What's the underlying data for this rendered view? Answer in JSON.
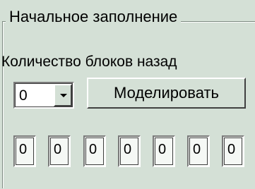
{
  "group": {
    "title": "Начальное заполнение"
  },
  "blocks_label": "Количество блоков назад",
  "blocks_combo": {
    "value": "0"
  },
  "simulate_button": {
    "label": "Моделировать"
  },
  "cells": [
    "0",
    "0",
    "0",
    "0",
    "0",
    "0",
    "0"
  ]
}
